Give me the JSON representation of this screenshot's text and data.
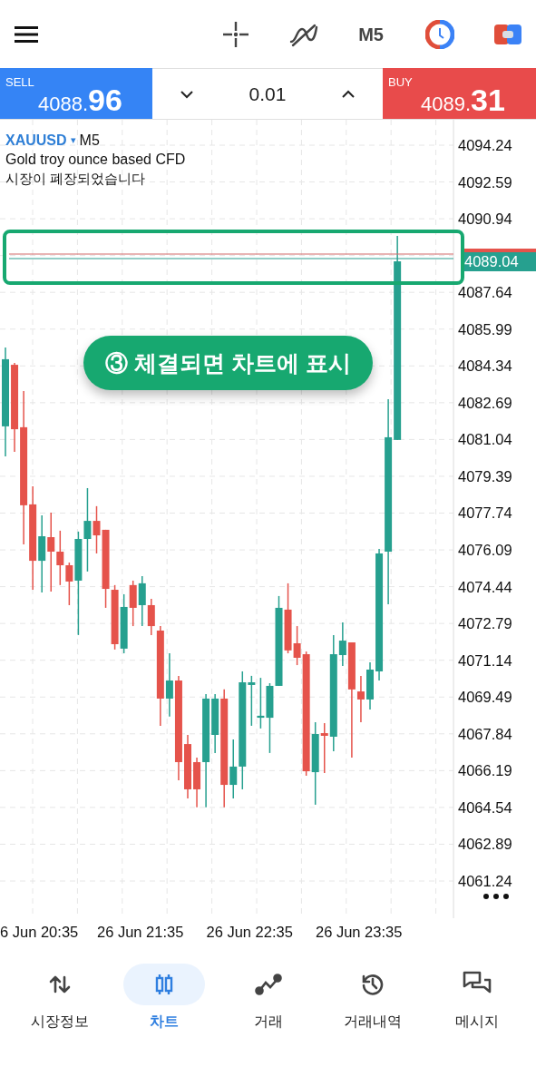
{
  "toolbar": {
    "timeframe": "M5"
  },
  "trade_panel": {
    "sell": {
      "label": "SELL",
      "price_head": "4088.",
      "price_tail": "96"
    },
    "lot": "0.01",
    "buy": {
      "label": "BUY",
      "price_head": "4089.",
      "price_tail": "31"
    }
  },
  "chart": {
    "symbol": "XAUUSD",
    "symbol_arrow": "▾",
    "timeframe": "M5",
    "description": "Gold troy ounce based CFD",
    "status": "시장이 폐장되었습니다",
    "current_price": "4089.04",
    "time_labels": [
      "6 Jun 20:35",
      "26 Jun 21:35",
      "26 Jun 22:35",
      "26 Jun 23:35"
    ],
    "callout": "③ 체결되면 차트에 표시",
    "chart_data": {
      "type": "candlestick",
      "ylim": [
        4059.57,
        4095.38
      ],
      "grid": true,
      "yticks": [
        {
          "value": 4094.24,
          "label": "4094.24"
        },
        {
          "value": 4092.59,
          "label": "4092.59"
        },
        {
          "value": 4090.94,
          "label": "4090.94"
        },
        {
          "value": 4087.64,
          "label": "4087.64"
        },
        {
          "value": 4085.99,
          "label": "4085.99"
        },
        {
          "value": 4084.34,
          "label": "4084.34"
        },
        {
          "value": 4082.69,
          "label": "4082.69"
        },
        {
          "value": 4081.04,
          "label": "4081.04"
        },
        {
          "value": 4079.39,
          "label": "4079.39"
        },
        {
          "value": 4077.74,
          "label": "4077.74"
        },
        {
          "value": 4076.09,
          "label": "4076.09"
        },
        {
          "value": 4074.44,
          "label": "4074.44"
        },
        {
          "value": 4072.79,
          "label": "4072.79"
        },
        {
          "value": 4071.14,
          "label": "4071.14"
        },
        {
          "value": 4069.49,
          "label": "4069.49"
        },
        {
          "value": 4067.84,
          "label": "4067.84"
        },
        {
          "value": 4066.19,
          "label": "4066.19"
        },
        {
          "value": 4064.54,
          "label": "4064.54"
        },
        {
          "value": 4062.89,
          "label": "4062.89"
        },
        {
          "value": 4061.24,
          "label": "4061.24"
        }
      ],
      "categories": [
        null,
        null,
        null,
        null,
        null,
        null,
        null,
        null,
        null,
        null,
        null,
        null,
        null,
        null,
        null,
        null,
        null,
        null,
        null,
        null,
        null,
        null,
        null,
        null,
        null,
        null,
        null,
        null,
        null,
        null,
        null,
        null,
        null,
        null,
        null,
        null,
        null,
        null,
        null,
        null,
        null,
        null,
        null,
        null
      ],
      "ohlc": [
        [
          4081.63,
          4085.17,
          4080.28,
          4084.64
        ],
        [
          4084.39,
          4084.47,
          4080.49,
          4081.5
        ],
        [
          4081.59,
          4083.21,
          4076.34,
          4078.09
        ],
        [
          4078.13,
          4078.94,
          4074.3,
          4075.6
        ],
        [
          4075.6,
          4077.64,
          4074.18,
          4076.7
        ],
        [
          4076.66,
          4077.76,
          4074.22,
          4076.01
        ],
        [
          4076.01,
          4076.95,
          4074.51,
          4075.4
        ],
        [
          4075.4,
          4075.52,
          4073.61,
          4074.67
        ],
        [
          4074.71,
          4076.91,
          4072.27,
          4076.58
        ],
        [
          4076.58,
          4078.86,
          4075.12,
          4077.39
        ],
        [
          4077.39,
          4078.05,
          4075.93,
          4076.74
        ],
        [
          4076.99,
          4076.99,
          4073.49,
          4074.34
        ],
        [
          4074.3,
          4074.51,
          4071.62,
          4071.86
        ],
        [
          4071.66,
          4074.1,
          4071.45,
          4073.53
        ],
        [
          4074.51,
          4074.71,
          4072.67,
          4073.49
        ],
        [
          4073.61,
          4074.91,
          4072.67,
          4074.59
        ],
        [
          4073.61,
          4073.89,
          4072.27,
          4072.67
        ],
        [
          4072.47,
          4072.67,
          4068.2,
          4069.42
        ],
        [
          4069.42,
          4071.45,
          4068.61,
          4070.23
        ],
        [
          4070.23,
          4070.44,
          4065.76,
          4066.57
        ],
        [
          4067.38,
          4067.79,
          4064.94,
          4065.35
        ],
        [
          4066.57,
          4066.77,
          4064.54,
          4065.35
        ],
        [
          4066.57,
          4069.62,
          4064.54,
          4069.42
        ],
        [
          4067.79,
          4069.62,
          4066.98,
          4069.42
        ],
        [
          4069.42,
          4069.83,
          4064.54,
          4065.55
        ],
        [
          4065.55,
          4067.59,
          4064.94,
          4066.37
        ],
        [
          4066.37,
          4070.64,
          4065.35,
          4070.15
        ],
        [
          4070.03,
          4070.44,
          4068.2,
          4070.15
        ],
        [
          4068.56,
          4070.35,
          4068.08,
          4068.65
        ],
        [
          4068.56,
          4070.11,
          4066.98,
          4069.99
        ],
        [
          4069.99,
          4074.02,
          4069.99,
          4073.49
        ],
        [
          4073.41,
          4074.59,
          4071.45,
          4071.58
        ],
        [
          4071.9,
          4072.67,
          4070.92,
          4071.25
        ],
        [
          4071.41,
          4071.53,
          4065.96,
          4066.16
        ],
        [
          4066.12,
          4068.36,
          4064.66,
          4067.83
        ],
        [
          4067.87,
          4068.32,
          4066.08,
          4067.75
        ],
        [
          4067.71,
          4072.27,
          4067.06,
          4071.41
        ],
        [
          4071.37,
          4072.84,
          4070.88,
          4072.02
        ],
        [
          4071.94,
          4071.94,
          4066.77,
          4069.83
        ],
        [
          4069.74,
          4070.44,
          4068.36,
          4069.38
        ],
        [
          4069.38,
          4071.05,
          4068.93,
          4070.72
        ],
        [
          4070.64,
          4076.13,
          4070.23,
          4075.93
        ],
        [
          4076.01,
          4082.85,
          4073.65,
          4081.14
        ],
        [
          4081.02,
          4090.17,
          4081.02,
          4089.03
        ]
      ]
    }
  },
  "bottom_nav": [
    {
      "label": "시장정보",
      "selected": false
    },
    {
      "label": "차트",
      "selected": true
    },
    {
      "label": "거래",
      "selected": false
    },
    {
      "label": "거래내역",
      "selected": false
    },
    {
      "label": "메시지",
      "selected": false
    }
  ]
}
